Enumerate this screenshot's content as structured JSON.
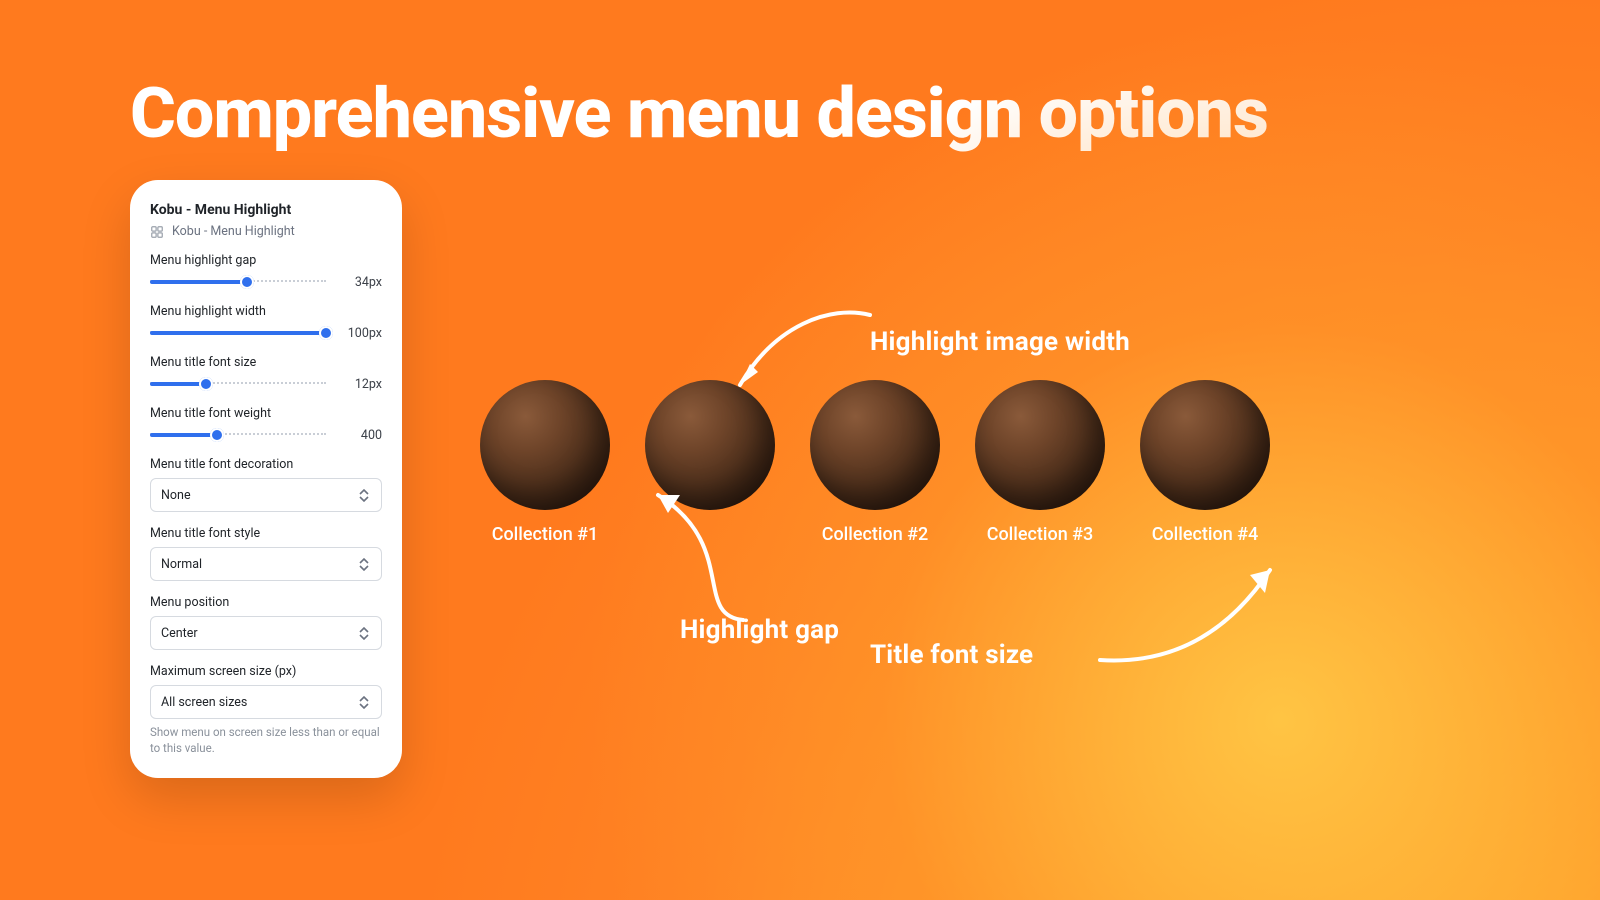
{
  "headline": "Comprehensive menu design options",
  "panel": {
    "title": "Kobu - Menu Highlight",
    "breadcrumb": "Kobu - Menu Highlight",
    "sliders": [
      {
        "label": "Menu highlight gap",
        "value": "34px",
        "pct": 55
      },
      {
        "label": "Menu highlight width",
        "value": "100px",
        "pct": 100
      },
      {
        "label": "Menu title font size",
        "value": "12px",
        "pct": 32
      },
      {
        "label": "Menu title font weight",
        "value": "400",
        "pct": 38
      }
    ],
    "selects": [
      {
        "label": "Menu title font decoration",
        "value": "None"
      },
      {
        "label": "Menu title font style",
        "value": "Normal"
      },
      {
        "label": "Menu position",
        "value": "Center"
      },
      {
        "label": "Maximum screen size (px)",
        "value": "All screen sizes",
        "help": "Show menu on screen size less than or equal to this value."
      }
    ]
  },
  "preview": {
    "items": [
      {
        "caption": "Collection #1"
      },
      {
        "caption": ""
      },
      {
        "caption": "Collection #2"
      },
      {
        "caption": "Collection #3"
      },
      {
        "caption": "Collection #4"
      }
    ]
  },
  "annotations": {
    "width": "Highlight image width",
    "gap": "Highlight gap",
    "font": "Title font size"
  }
}
